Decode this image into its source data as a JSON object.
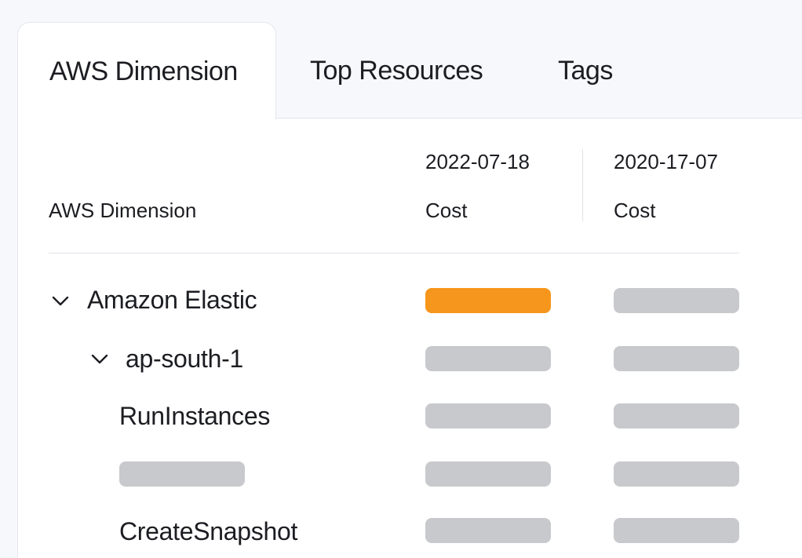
{
  "tabs": [
    {
      "label": "AWS Dimension",
      "active": true
    },
    {
      "label": "Top Resources",
      "active": false
    },
    {
      "label": "Tags",
      "active": false
    }
  ],
  "table": {
    "first_column_header": "AWS Dimension",
    "columns": [
      {
        "date": "2022-07-18",
        "metric": "Cost"
      },
      {
        "date": "2020-17-07",
        "metric": "Cost"
      }
    ],
    "rows": [
      {
        "label": "Amazon Elastic",
        "expanded": true,
        "level": 0,
        "values_hidden": true,
        "highlight_column": 0
      },
      {
        "label": "ap-south-1",
        "expanded": true,
        "level": 1,
        "values_hidden": true
      },
      {
        "label": "RunInstances",
        "level": 2,
        "values_hidden": true
      },
      {
        "label": "",
        "level": 2,
        "label_hidden": true,
        "values_hidden": true
      },
      {
        "label": "CreateSnapshot",
        "level": 2,
        "values_hidden": true
      }
    ]
  },
  "colors": {
    "accent": "#f7961c",
    "placeholder": "#c8c9cd",
    "background": "#f7f8fc"
  },
  "icons": {
    "expand": "chevron-down-icon"
  }
}
